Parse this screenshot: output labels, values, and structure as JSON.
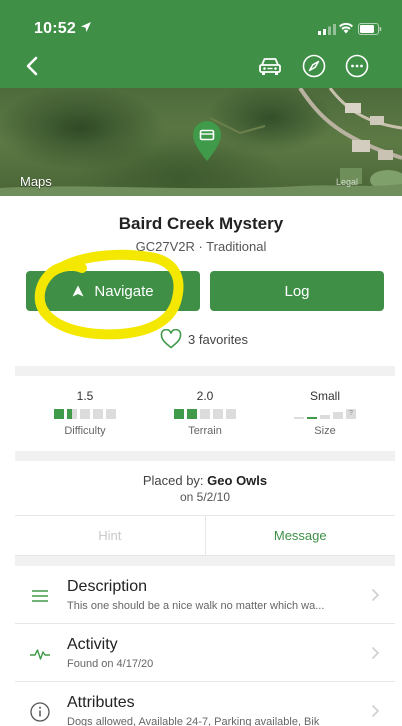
{
  "status_bar": {
    "time": "10:52"
  },
  "map": {
    "label": "Maps",
    "legal": "Legal"
  },
  "cache": {
    "name": "Baird Creek Mystery",
    "code_type": "GC27V2R · Traditional"
  },
  "actions": {
    "navigate_label": "Navigate",
    "log_label": "Log"
  },
  "favorites": {
    "text": "3 favorites"
  },
  "stats": {
    "difficulty": {
      "value": "1.5",
      "label": "Difficulty",
      "level": 1.5,
      "max": 5
    },
    "terrain": {
      "value": "2.0",
      "label": "Terrain",
      "level": 2.0,
      "max": 5
    },
    "size": {
      "value": "Small",
      "label": "Size",
      "level": 2,
      "max": 4
    }
  },
  "placed": {
    "prefix": "Placed by:",
    "owner": "Geo Owls",
    "date": "on 5/2/10"
  },
  "tabs": {
    "hint": "Hint",
    "message": "Message"
  },
  "rows": [
    {
      "title": "Description",
      "subtitle": "This one should be a nice walk no matter which wa...",
      "icon": "list-icon"
    },
    {
      "title": "Activity",
      "subtitle": "Found on 4/17/20",
      "icon": "activity-icon"
    },
    {
      "title": "Attributes",
      "subtitle": "Dogs allowed, Available 24-7, Parking available, Bik",
      "icon": "info-icon"
    }
  ],
  "colors": {
    "brand_green": "#3f8f47",
    "highlight": "#f5e800"
  }
}
